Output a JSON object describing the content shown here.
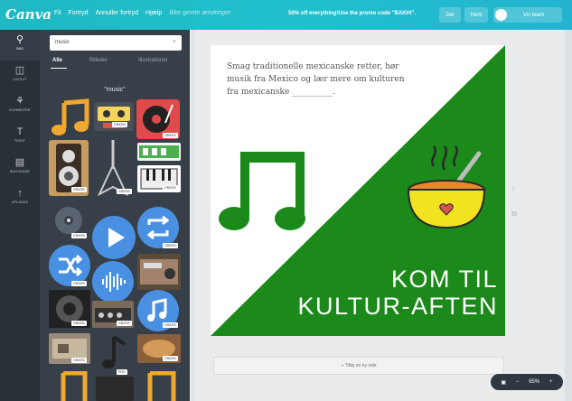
{
  "topbar": {
    "logo": "Canva",
    "menu": [
      "Fil",
      "Fortryd",
      "Annuller fortryd",
      "Hjælp"
    ],
    "save_status": "Ikke gemte ændringer",
    "promo": "50% off everything!Use the promo code \"BAKHI\".",
    "share_label": "Del",
    "download_label": "Hent",
    "team_label": "Vis team"
  },
  "leftnav": {
    "items": [
      {
        "icon": "search-icon",
        "glyph": "⚲",
        "label": "SØG"
      },
      {
        "icon": "layout-icon",
        "glyph": "◫",
        "label": "LAYOUT"
      },
      {
        "icon": "elements-icon",
        "glyph": "⚘",
        "label": "ELEMENTER"
      },
      {
        "icon": "text-icon",
        "glyph": "T",
        "label": "TEKST"
      },
      {
        "icon": "background-icon",
        "glyph": "▤",
        "label": "BAGGRUND"
      },
      {
        "icon": "upload-icon",
        "glyph": "↑",
        "label": "UPLOADS"
      }
    ]
  },
  "panel": {
    "search_value": "music",
    "tabs": [
      "Alle",
      "Billeder",
      "Illustrationer"
    ],
    "query_label": "\"music\"",
    "free_badge": "GRATIS",
    "pro_badge": "PRO"
  },
  "canvas": {
    "body_text": "Smag traditionelle mexicanske retter, hør musik fra Mexico og lær mere om kulturen fra mexicanske __________.",
    "headline_line1": "KOM TIL",
    "headline_line2": "KULTUR-AFTEN",
    "add_page": "+ Tilføj en ny side",
    "zoom_level": "65%"
  },
  "colors": {
    "topbar": "#21c0cc",
    "panel": "#373f48",
    "canvas_green": "#1b8a1b",
    "bowl_yellow": "#f2e321",
    "soup_orange": "#e8892a"
  }
}
